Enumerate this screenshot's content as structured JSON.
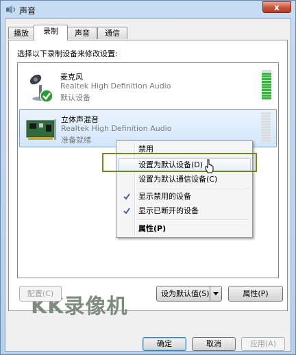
{
  "window": {
    "title": "声音",
    "close_label": "x"
  },
  "tabs": [
    {
      "label": "播放",
      "active": false
    },
    {
      "label": "录制",
      "active": true
    },
    {
      "label": "声音",
      "active": false
    },
    {
      "label": "通信",
      "active": false
    }
  ],
  "instruction": "选择以下录制设备来修改设置:",
  "devices": [
    {
      "name": "麦克风",
      "description": "Realtek High Definition Audio",
      "status": "默认设备",
      "level": 0.92
    },
    {
      "name": "立体声混音",
      "description": "Realtek High Definition Audio",
      "status": "准备就绪",
      "level": 0.0
    }
  ],
  "context_menu": {
    "items": [
      {
        "label": "禁用"
      },
      {
        "label": "设置为默认设备(D)"
      },
      {
        "label": "设置为默认通信设备(C)"
      },
      {
        "label": "显示禁用的设备",
        "checked": true
      },
      {
        "label": "显示已断开的设备",
        "checked": true
      },
      {
        "label": "属性(P)",
        "bold": true
      }
    ]
  },
  "watermark": "KK录像机",
  "buttons": {
    "configure": "配置(C)",
    "set_default": "设为默认值(S)",
    "properties": "属性(P)",
    "ok": "确定",
    "cancel": "取消",
    "apply": "应用(A)"
  },
  "colors": {
    "level_active": "#3cb043",
    "level_inactive": "#d8dde2",
    "highlight": "#6b8a1c"
  }
}
